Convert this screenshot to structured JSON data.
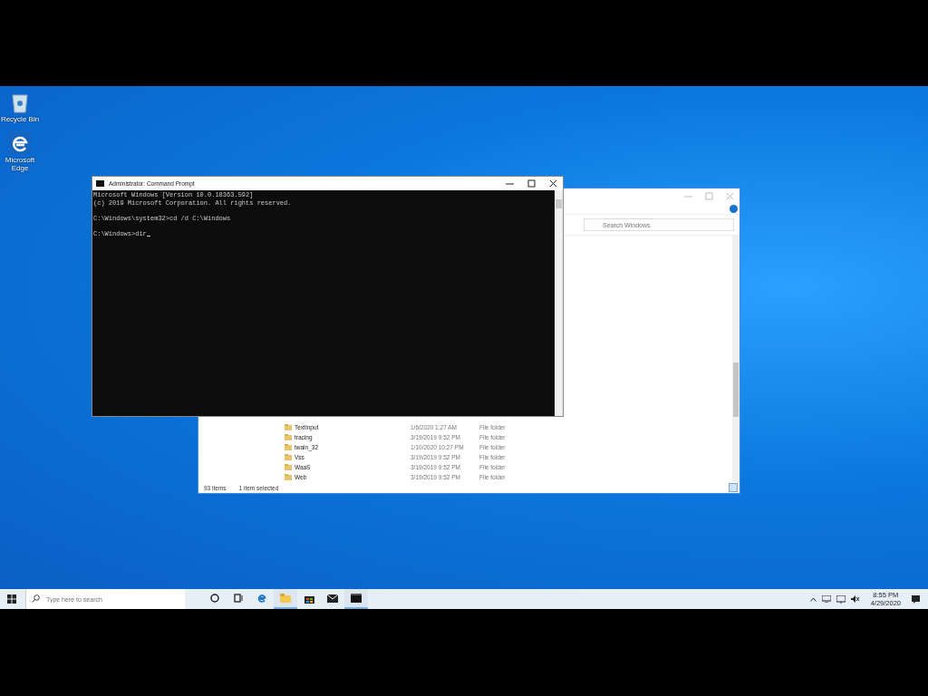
{
  "desktop": {
    "icons": [
      {
        "kind": "bin",
        "label": "Recycle Bin"
      },
      {
        "kind": "edge",
        "label": "Microsoft Edge"
      }
    ]
  },
  "explorer": {
    "search": {
      "placeholder": "Search Windows"
    },
    "files": [
      {
        "name": "TextInput",
        "date": "1/6/2020 1:27 AM",
        "type": "File folder"
      },
      {
        "name": "tracing",
        "date": "3/19/2019 9:52 PM",
        "type": "File folder"
      },
      {
        "name": "twain_32",
        "date": "1/10/2020 10:27 PM",
        "type": "File folder"
      },
      {
        "name": "Vss",
        "date": "3/19/2019 9:52 PM",
        "type": "File folder"
      },
      {
        "name": "WaaS",
        "date": "3/19/2019 9:52 PM",
        "type": "File folder"
      },
      {
        "name": "Web",
        "date": "3/19/2019 9:52 PM",
        "type": "File folder"
      }
    ],
    "status": {
      "items": "93 items",
      "selection": "1 item selected"
    }
  },
  "cmd": {
    "title": "Administrator: Command Prompt",
    "blocks": [
      [
        "Microsoft Windows [Version 10.0.18363.592]",
        "(c) 2019 Microsoft Corporation. All rights reserved."
      ],
      [
        "C:\\Windows\\system32>cd /d C:\\Windows"
      ],
      [
        "C:\\Windows>dir"
      ]
    ]
  },
  "taskbar": {
    "search": {
      "placeholder": "Type here to search"
    },
    "apps": [
      {
        "kind": "cortana",
        "active": false
      },
      {
        "kind": "taskview",
        "active": false
      },
      {
        "kind": "edge",
        "active": false
      },
      {
        "kind": "folder",
        "active": true
      },
      {
        "kind": "store",
        "active": false
      },
      {
        "kind": "mail",
        "active": false
      },
      {
        "kind": "terminal",
        "active": true
      }
    ],
    "clock": {
      "time": "8:55 PM",
      "date": "4/29/2020"
    }
  }
}
